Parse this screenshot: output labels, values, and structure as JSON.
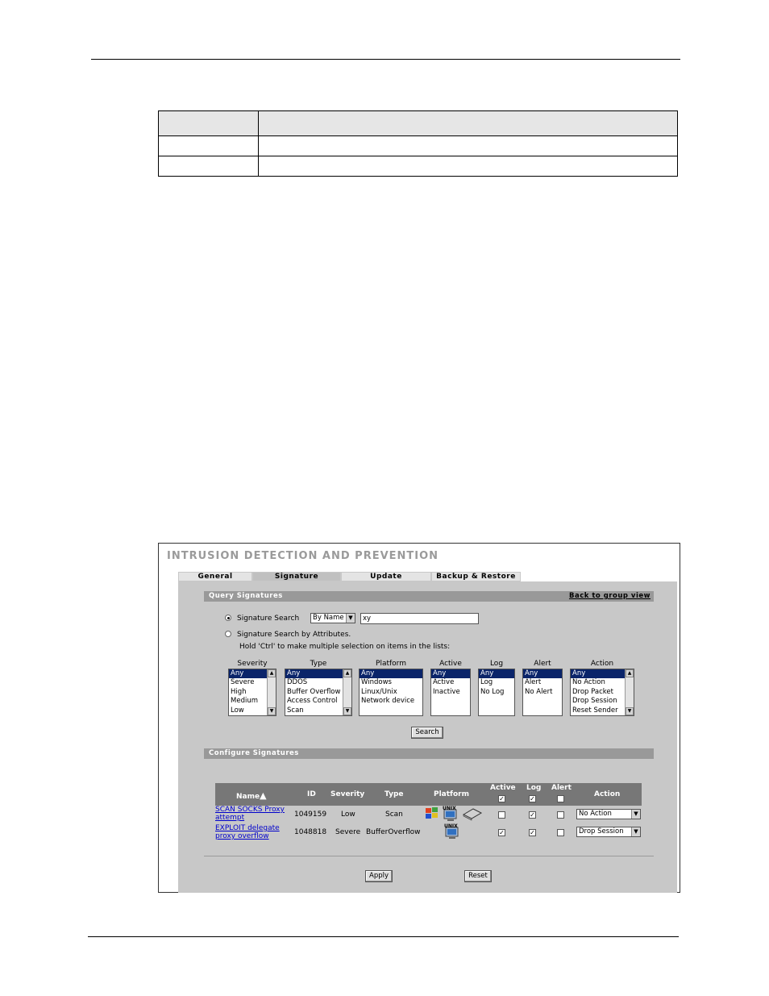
{
  "app": {
    "title": "INTRUSION DETECTION AND PREVENTION"
  },
  "tabs": [
    {
      "label": "General"
    },
    {
      "label": "Signature"
    },
    {
      "label": "Update"
    },
    {
      "label": "Backup & Restore"
    }
  ],
  "query": {
    "section_title": "Query Signatures",
    "back_link": "Back to group view",
    "search_radio_label": "Signature Search",
    "search_by_select": "By Name",
    "search_value": "xy",
    "attr_radio_label": "Signature Search by Attributes.",
    "hint": "Hold 'Ctrl' to make multiple selection on items in the lists:",
    "lists": {
      "severity": {
        "label": "Severity",
        "options": [
          "Any",
          "Severe",
          "High",
          "Medium",
          "Low"
        ]
      },
      "type": {
        "label": "Type",
        "options": [
          "Any",
          "DDOS",
          "Buffer Overflow",
          "Access Control",
          "Scan"
        ]
      },
      "platform": {
        "label": "Platform",
        "options": [
          "Any",
          "Windows",
          "Linux/Unix",
          "Network device"
        ]
      },
      "active": {
        "label": "Active",
        "options": [
          "Any",
          "Active",
          "Inactive"
        ]
      },
      "log": {
        "label": "Log",
        "options": [
          "Any",
          "Log",
          "No Log"
        ]
      },
      "alert": {
        "label": "Alert",
        "options": [
          "Any",
          "Alert",
          "No Alert"
        ]
      },
      "action": {
        "label": "Action",
        "options": [
          "Any",
          "No Action",
          "Drop Packet",
          "Drop Session",
          "Reset Sender"
        ]
      }
    },
    "search_button": "Search"
  },
  "configure": {
    "section_title": "Configure Signatures",
    "headers": {
      "name": "Name",
      "id": "ID",
      "severity": "Severity",
      "type": "Type",
      "platform": "Platform",
      "active": "Active",
      "log": "Log",
      "alert": "Alert",
      "action": "Action"
    },
    "header_checks": {
      "active": true,
      "log": true,
      "alert": false
    },
    "rows": [
      {
        "name_line1": "SCAN SOCKS Proxy",
        "name_line2": "attempt",
        "id": "1049159",
        "severity": "Low",
        "type": "Scan",
        "active": false,
        "log": true,
        "alert": false,
        "action": "No Action"
      },
      {
        "name_line1": "EXPLOIT delegate",
        "name_line2": "proxy overflow",
        "id": "1048818",
        "severity": "Severe",
        "type": "BufferOverflow",
        "active": true,
        "log": true,
        "alert": false,
        "action": "Drop Session"
      }
    ],
    "icons": {
      "windows": "windows-icon",
      "unix": "unix-icon",
      "network": "network-device-icon"
    },
    "unix_badge": "UNIX",
    "apply_button": "Apply",
    "reset_button": "Reset"
  }
}
